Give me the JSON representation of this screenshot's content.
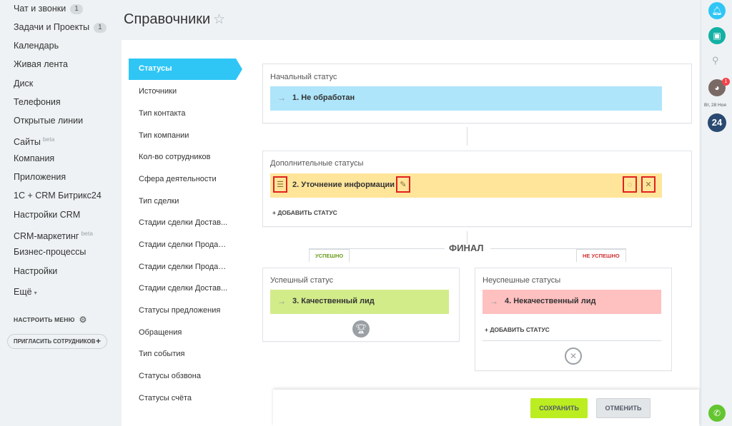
{
  "sidebar": {
    "items": [
      {
        "label": "Чат и звонки",
        "badge": "1"
      },
      {
        "label": "Задачи и Проекты",
        "badge": "1"
      },
      {
        "label": "Календарь"
      },
      {
        "label": "Живая лента"
      },
      {
        "label": "Диск"
      },
      {
        "label": "Телефония"
      },
      {
        "label": "Открытые линии"
      },
      {
        "label": "Сайты",
        "beta": "beta"
      },
      {
        "label": "Компания"
      },
      {
        "label": "Приложения"
      },
      {
        "label": "1С + CRM Битрикс24"
      },
      {
        "label": "Настройки CRM"
      },
      {
        "label": "CRM-маркетинг",
        "beta": "beta"
      },
      {
        "label": "Бизнес-процессы"
      },
      {
        "label": "Настройки"
      },
      {
        "label": "Ещё"
      }
    ],
    "configure_menu": "НАСТРОИТЬ МЕНЮ",
    "invite": "ПРИГЛАСИТЬ СОТРУДНИКОВ"
  },
  "page": {
    "title": "Справочники"
  },
  "submenu": [
    "Статусы",
    "Источники",
    "Тип контакта",
    "Тип компании",
    "Кол-во сотрудников",
    "Сфера деятельности",
    "Тип сделки",
    "Стадии сделки Достав...",
    "Стадии сделки Продаж...",
    "Стадии сделки Продаж...",
    "Стадии сделки Достав...",
    "Статусы предложения",
    "Обращения",
    "Тип события",
    "Статусы обзвона",
    "Статусы счёта"
  ],
  "initial": {
    "title": "Начальный статус",
    "status": "1. Не обработан"
  },
  "additional": {
    "title": "Дополнительные статусы",
    "status": "2. Уточнение информации",
    "add": "+ ДОБАВИТЬ СТАТУС"
  },
  "final": {
    "label": "ФИНАЛ",
    "success_tab": "УСПЕШНО",
    "fail_tab": "НЕ УСПЕШНО",
    "success_title": "Успешный статус",
    "success_status": "3. Качественный лид",
    "fail_title": "Неуспешные статусы",
    "fail_status": "4. Некачественный лид",
    "fail_add": "+ ДОБАВИТЬ СТАТУС"
  },
  "actions": {
    "save": "СОХРАНИТЬ",
    "cancel": "ОТМЕНИТЬ"
  },
  "right_rail": {
    "date": "Вт, 28 Ноя",
    "notifications_badge": "1",
    "logo": "24"
  },
  "colors": {
    "accent": "#2fc6f6",
    "initial_status": "#aee5fa",
    "additional_status": "#ffe59a",
    "success_status": "#d2ec8a",
    "fail_status": "#ffc0c0",
    "save_button": "#bbed21",
    "success_tab": "#6a9c1c",
    "fail_tab": "#d03030"
  }
}
